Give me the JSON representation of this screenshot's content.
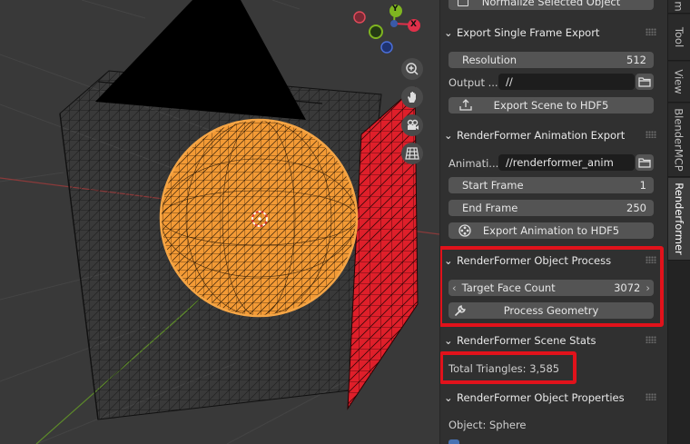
{
  "panel": {
    "normalize_button": "Normalize Selected Object",
    "export_single": {
      "header": "Export Single Frame Export",
      "resolution_label": "Resolution",
      "resolution_value": "512",
      "output_label": "Output ...",
      "output_value": "//",
      "export_button": "Export Scene to HDF5"
    },
    "animation_export": {
      "header": "RenderFormer Animation Export",
      "anim_label": "Animati...",
      "anim_value": "//renderformer_anim",
      "start_label": "Start Frame",
      "start_value": "1",
      "end_label": "End Frame",
      "end_value": "250",
      "export_button": "Export Animation to HDF5"
    },
    "object_process": {
      "header": "RenderFormer Object Process",
      "face_label": "Target Face Count",
      "face_value": "3072",
      "process_button": "Process Geometry"
    },
    "scene_stats": {
      "header": "RenderFormer Scene Stats",
      "triangles": "Total Triangles: 3,585"
    },
    "object_properties": {
      "header": "RenderFormer Object Properties",
      "object": "Object: Sphere"
    }
  },
  "tabs": [
    "m",
    "Tool",
    "View",
    "BlenderMCP",
    "Renderformer"
  ],
  "gizmo": {
    "y_label": "Y",
    "x_label": "X"
  },
  "colors": {
    "highlight": "#e1121b",
    "selection": "#f0902a",
    "plane": "#e0202a"
  }
}
